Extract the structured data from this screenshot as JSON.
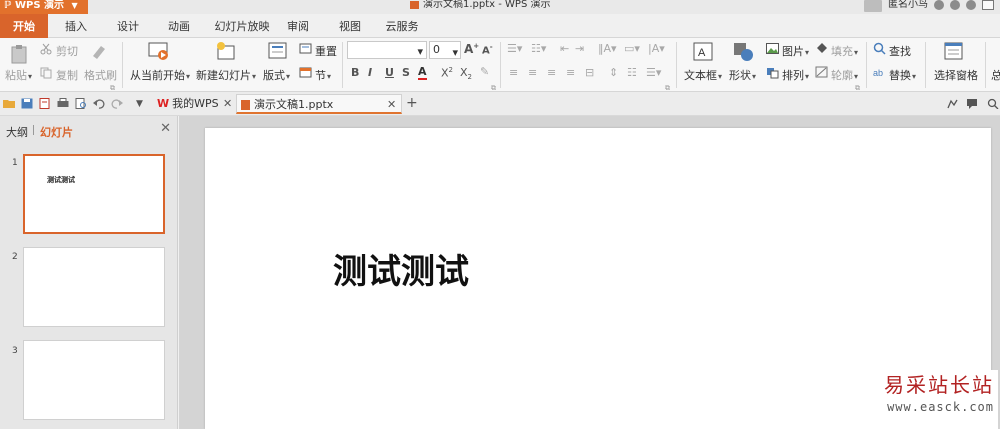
{
  "titlebar": {
    "app_label": "WPS 演示",
    "doc_title": "演示文稿1.pptx - WPS 演示",
    "user_name": "匿名小鸟"
  },
  "menu": {
    "tabs": [
      "开始",
      "插入",
      "设计",
      "动画",
      "幻灯片放映",
      "审阅",
      "视图",
      "云服务"
    ],
    "active_index": 0
  },
  "ribbon": {
    "paste": "粘贴",
    "cut": "剪切",
    "copy": "复制",
    "format_painter": "格式刷",
    "from_current": "从当前开始",
    "new_slide": "新建幻灯片",
    "layout": "版式",
    "reset": "重置",
    "section": "节",
    "font_name": "",
    "font_size": "0",
    "textbox": "文本框",
    "shape": "形状",
    "picture": "图片",
    "fill": "填充",
    "arrange": "排列",
    "outline": "轮廓",
    "find": "查找",
    "replace": "替换",
    "select_pane": "选择窗格",
    "more": "总"
  },
  "quickbar": {
    "tabs": [
      {
        "label": "我的WPS"
      },
      {
        "label": "演示文稿1.pptx"
      }
    ],
    "active_tab": 1
  },
  "leftpanel": {
    "outline_tab": "大纲",
    "slides_tab": "幻灯片",
    "slides": [
      {
        "number": "1",
        "text": "测试测试",
        "selected": true
      },
      {
        "number": "2",
        "text": ""
      },
      {
        "number": "3",
        "text": ""
      }
    ]
  },
  "slide": {
    "title_text": "测试测试"
  },
  "watermark": {
    "name": "易采站长站",
    "url": "www.easck.com"
  },
  "colors": {
    "accent": "#d9642b",
    "app_button": "#e2712c",
    "panel_bg": "#e6e6e6",
    "canvas_bg": "#d4d4d4"
  }
}
